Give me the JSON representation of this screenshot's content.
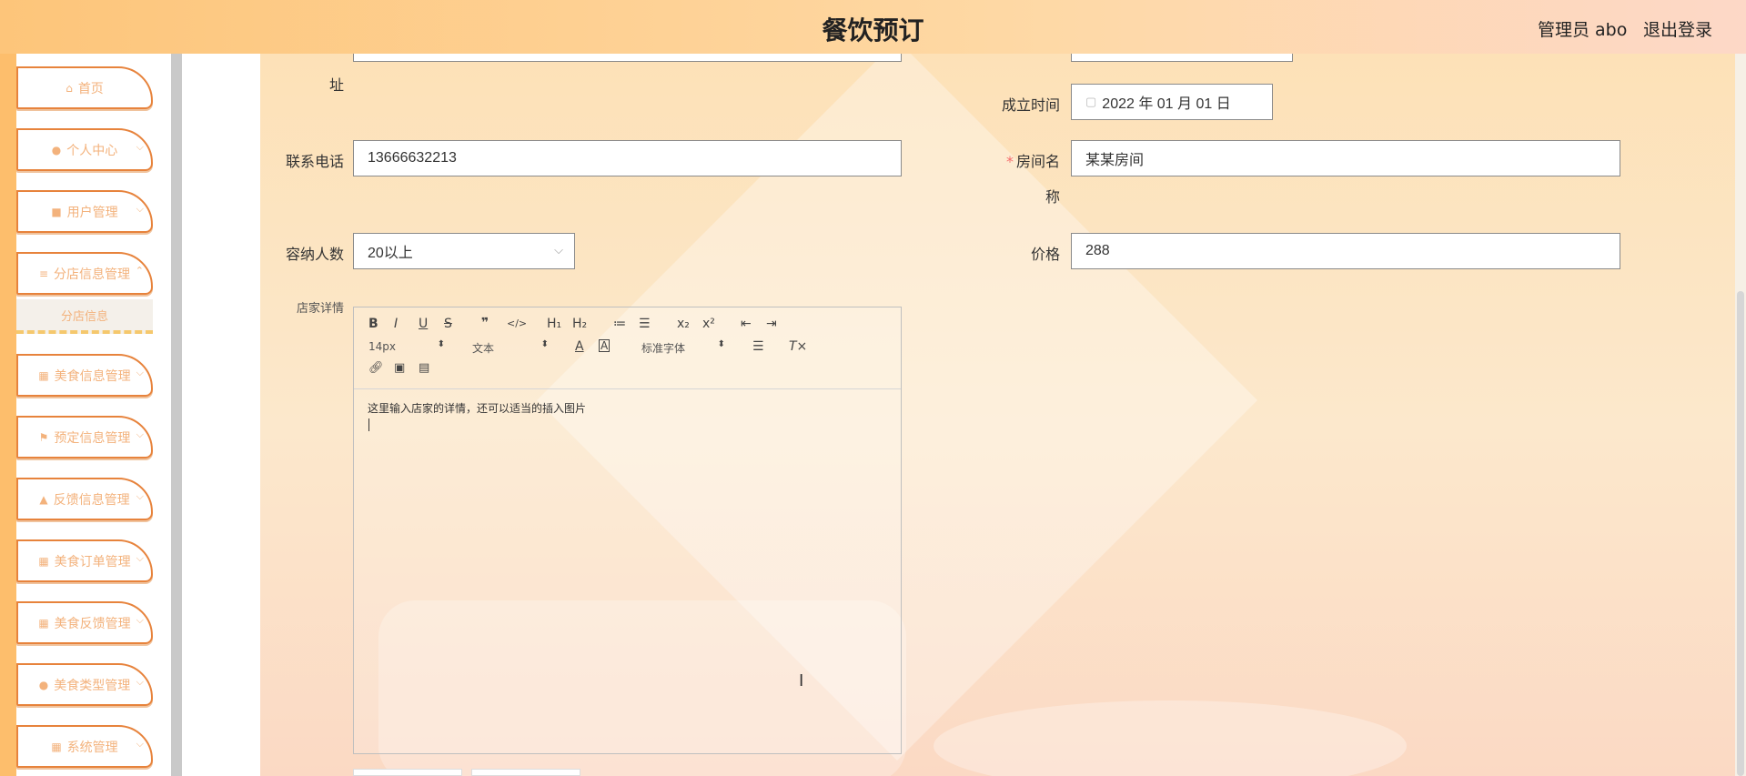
{
  "header": {
    "title": "餐饮预订",
    "user_label": "管理员 abo",
    "logout_label": "退出登录"
  },
  "sidebar": {
    "items": [
      {
        "label": "首页",
        "icon": "home-icon",
        "glyph": "⌂"
      },
      {
        "label": "个人中心",
        "icon": "person-icon",
        "glyph": "●"
      },
      {
        "label": "用户管理",
        "icon": "monitor-icon",
        "glyph": "■"
      },
      {
        "label": "分店信息管理",
        "icon": "list-icon",
        "glyph": "≡"
      },
      {
        "label": "美食信息管理",
        "icon": "grid-icon",
        "glyph": "▦"
      },
      {
        "label": "预定信息管理",
        "icon": "flag-icon",
        "glyph": "⚑"
      },
      {
        "label": "反馈信息管理",
        "icon": "stamp-icon",
        "glyph": "▲"
      },
      {
        "label": "美食订单管理",
        "icon": "apps-icon",
        "glyph": "▦"
      },
      {
        "label": "美食反馈管理",
        "icon": "grid-icon",
        "glyph": "▦"
      },
      {
        "label": "美食类型管理",
        "icon": "location-icon",
        "glyph": "●"
      },
      {
        "label": "系统管理",
        "icon": "grid-icon",
        "glyph": "▦"
      }
    ],
    "submenu_label": "分店信息"
  },
  "form": {
    "address_label_tail": "址",
    "founded_label": "成立时间",
    "founded_value": "2022 年 01 月 01 日",
    "phone_label": "联系电话",
    "phone_value": "13666632213",
    "room_label_line1": "房间名",
    "room_label_line2": "称",
    "room_value": "某某房间",
    "capacity_label": "容纳人数",
    "capacity_value": "20以上",
    "price_label": "价格",
    "price_value": "288",
    "details_label": "店家详情"
  },
  "editor": {
    "toolbar_row1": [
      "B",
      "I",
      "U",
      "S",
      "❞",
      "</>",
      "H₁",
      "H₂",
      "≔",
      "☰",
      "x₂",
      "x²",
      "⇤",
      "⇥"
    ],
    "size_value": "14px",
    "type_value": "文本",
    "font_value": "标准字体",
    "content": "这里输入店家的详情，还可以适当的插入图片"
  },
  "colors": {
    "accent": "#e7833c",
    "menu_text": "#f3b27c",
    "header_from": "#fdc57a",
    "header_to": "#fdd8c7"
  }
}
